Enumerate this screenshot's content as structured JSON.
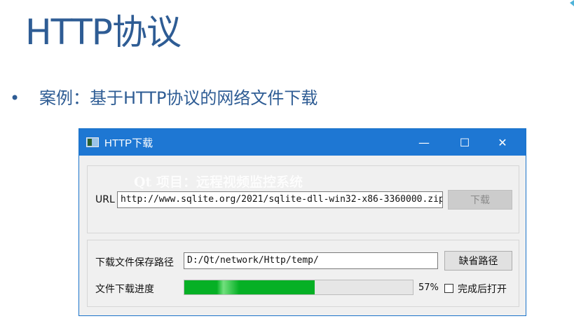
{
  "slide": {
    "title": "HTTP协议",
    "bullet_text": "案例：基于HTTP协议的网络文件下载"
  },
  "window": {
    "title": "HTTP下载",
    "controls": {
      "minimize": "—",
      "maximize": "☐",
      "close": "✕"
    },
    "watermark": "Qt 项目：远程视频监控系统",
    "url_label": "URL",
    "url_value": "http://www.sqlite.org/2021/sqlite-dll-win32-x86-3360000.zip",
    "download_button": "下载",
    "save_path_label": "下载文件保存路径",
    "save_path_value": "D:/Qt/network/Http/temp/",
    "default_path_button": "缺省路径",
    "progress_label": "文件下载进度",
    "progress_value": 57,
    "progress_text": "57%",
    "open_after_label": "完成后打开",
    "open_after_checked": false
  },
  "colors": {
    "title_blue": "#2e5c94",
    "titlebar": "#1e77d3",
    "progress_green": "#06b025"
  }
}
